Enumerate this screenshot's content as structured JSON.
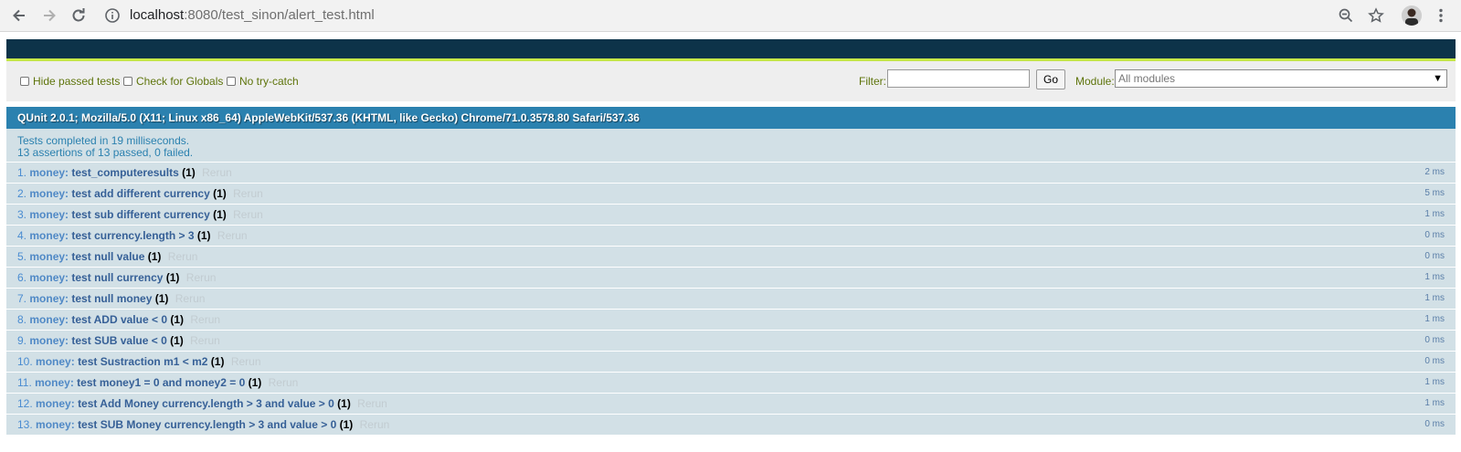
{
  "browser": {
    "url_host": "localhost",
    "url_rest": ":8080/test_sinon/alert_test.html"
  },
  "toolbar": {
    "hide_passed_label": "Hide passed tests",
    "check_globals_label": "Check for Globals",
    "no_try_catch_label": "No try-catch",
    "filter_label": "Filter:",
    "filter_value": "",
    "go_label": "Go",
    "module_label": "Module:",
    "module_selected": "All modules"
  },
  "user_agent": "QUnit 2.0.1; Mozilla/5.0 (X11; Linux x86_64) AppleWebKit/537.36 (KHTML, like Gecko) Chrome/71.0.3578.80 Safari/537.36",
  "result": {
    "line1": "Tests completed in 19 milliseconds.",
    "line2": "13 assertions of 13 passed, 0 failed."
  },
  "rerun_label": "Rerun",
  "tests": [
    {
      "num": "1.",
      "module": "money:",
      "name": "test_computeresults",
      "counts": "(1)",
      "time": "2 ms"
    },
    {
      "num": "2.",
      "module": "money:",
      "name": "test add different currency",
      "counts": "(1)",
      "time": "5 ms"
    },
    {
      "num": "3.",
      "module": "money:",
      "name": "test sub different currency",
      "counts": "(1)",
      "time": "1 ms"
    },
    {
      "num": "4.",
      "module": "money:",
      "name": "test currency.length > 3",
      "counts": "(1)",
      "time": "0 ms"
    },
    {
      "num": "5.",
      "module": "money:",
      "name": "test null value",
      "counts": "(1)",
      "time": "0 ms"
    },
    {
      "num": "6.",
      "module": "money:",
      "name": "test null currency",
      "counts": "(1)",
      "time": "1 ms"
    },
    {
      "num": "7.",
      "module": "money:",
      "name": "test null money",
      "counts": "(1)",
      "time": "1 ms"
    },
    {
      "num": "8.",
      "module": "money:",
      "name": "test ADD value < 0",
      "counts": "(1)",
      "time": "1 ms"
    },
    {
      "num": "9.",
      "module": "money:",
      "name": "test SUB value < 0",
      "counts": "(1)",
      "time": "0 ms"
    },
    {
      "num": "10.",
      "module": "money:",
      "name": "test Sustraction m1 < m2",
      "counts": "(1)",
      "time": "0 ms"
    },
    {
      "num": "11.",
      "module": "money:",
      "name": "test money1 = 0 and money2 = 0",
      "counts": "(1)",
      "time": "1 ms"
    },
    {
      "num": "12.",
      "module": "money:",
      "name": "test Add Money currency.length > 3 and value > 0",
      "counts": "(1)",
      "time": "1 ms"
    },
    {
      "num": "13.",
      "module": "money:",
      "name": "test SUB Money currency.length > 3 and value > 0",
      "counts": "(1)",
      "time": "0 ms"
    }
  ]
}
